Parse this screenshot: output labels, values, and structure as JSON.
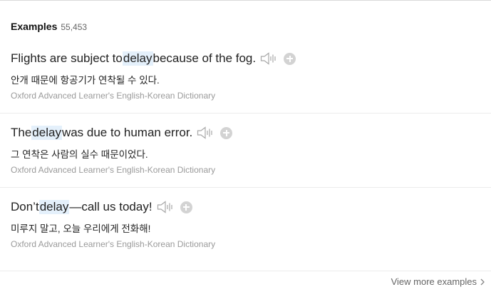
{
  "header": {
    "title": "Examples",
    "count": "55,453"
  },
  "examples": [
    {
      "en_before": "Flights are subject to ",
      "en_highlight": "delay",
      "en_after": " because of the fog.",
      "ko": "안개 때문에 항공기가 연착될 수 있다.",
      "source": "Oxford Advanced Learner's English-Korean Dictionary"
    },
    {
      "en_before": "The ",
      "en_highlight": "delay",
      "en_after": " was due to human error.",
      "ko": "그 연착은 사람의 실수 때문이었다.",
      "source": "Oxford Advanced Learner's English-Korean Dictionary"
    },
    {
      "en_before": "Don’t ",
      "en_highlight": "delay",
      "en_after": "—call us today!",
      "ko": "미루지 말고, 오늘 우리에게 전화해!",
      "source": "Oxford Advanced Learner's English-Korean Dictionary"
    }
  ],
  "footer": {
    "view_more": "View more examples"
  },
  "icons": {
    "audio": "speaker-icon",
    "add": "plus-circle-icon",
    "more": "chevron-right-icon"
  },
  "colors": {
    "highlight": "#e4f0fb",
    "muted": "#9a9a9a",
    "icon": "#a8a8a8"
  }
}
